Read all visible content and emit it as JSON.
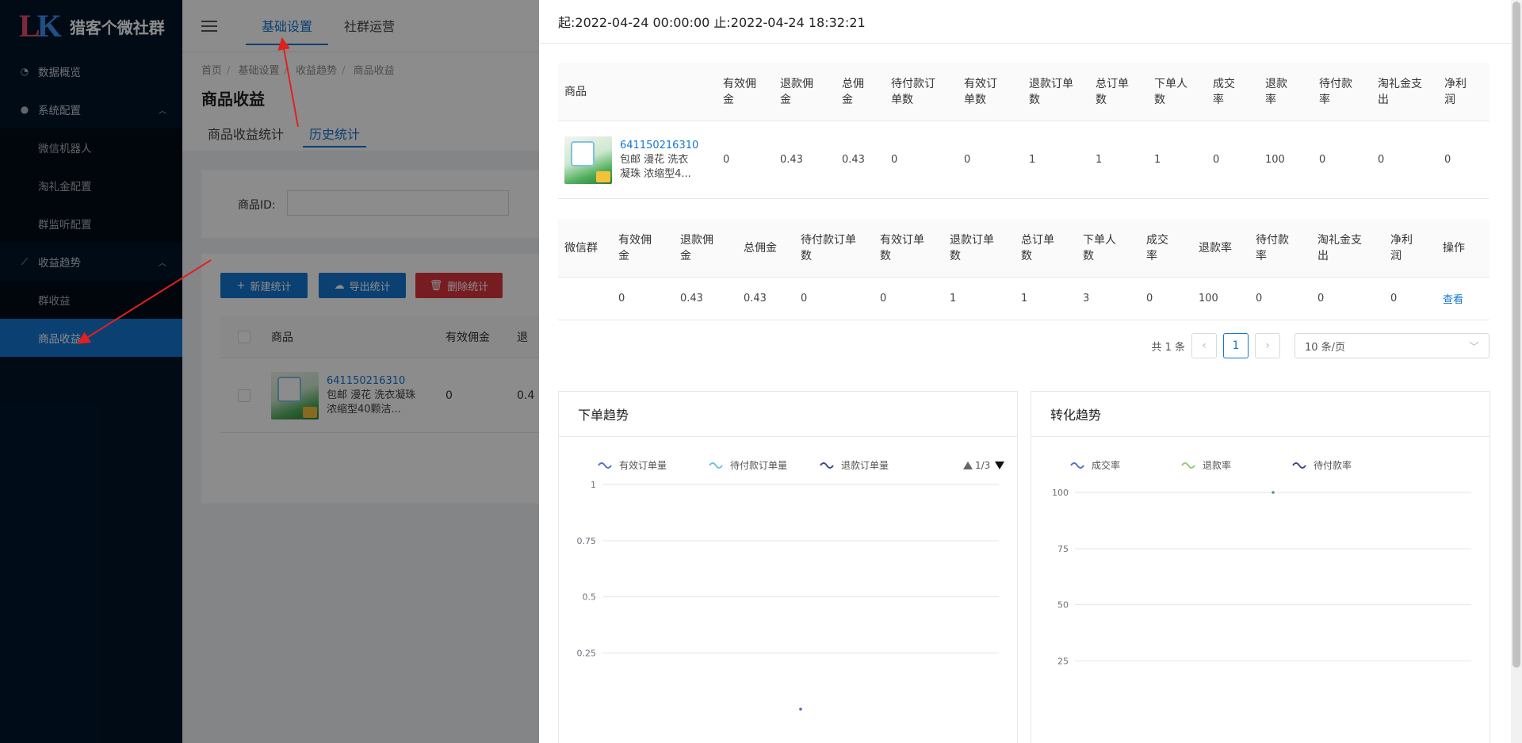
{
  "app": {
    "logo_mark_1": "L",
    "logo_mark_2": "K",
    "name": "猎客个微社群"
  },
  "sidebar": {
    "items": [
      {
        "label": "数据概览",
        "icon": "pie-chart-icon"
      },
      {
        "label": "系统配置",
        "icon": "wechat-icon"
      },
      {
        "label": "微信机器人"
      },
      {
        "label": "淘礼金配置"
      },
      {
        "label": "群监听配置"
      },
      {
        "label": "收益趋势",
        "icon": "line-chart-icon"
      },
      {
        "label": "群收益"
      },
      {
        "label": "商品收益"
      }
    ]
  },
  "topnav": {
    "tabs": [
      "基础设置",
      "社群运营"
    ]
  },
  "breadcrumb": [
    "首页",
    "基础设置",
    "收益趋势",
    "商品收益"
  ],
  "page": {
    "title": "商品收益",
    "sub_tabs": [
      "商品收益统计",
      "历史统计"
    ],
    "search_label": "商品ID:",
    "buttons": {
      "new": "新建统计",
      "export": "导出统计",
      "delete": "删除统计"
    },
    "list_headers": [
      "商品",
      "有效佣金",
      "退"
    ],
    "list_row": {
      "id": "641150216310",
      "desc": "包邮 漫花 洗衣凝珠 浓缩型40颗洁...",
      "effective": "0",
      "partial": "0.4"
    }
  },
  "drawer": {
    "range": "起:2022-04-24 00:00:00 止:2022-04-24 18:32:21",
    "table1": {
      "headers": [
        "商品",
        "有效佣金",
        "退款佣金",
        "总佣金",
        "待付款订单数",
        "有效订单数",
        "退款订单数",
        "总订单数",
        "下单人数",
        "成交率",
        "退款率",
        "待付款率",
        "淘礼金支出",
        "净利润"
      ],
      "row": {
        "id": "641150216310",
        "desc": "包邮 漫花 洗衣凝珠 浓缩型4...",
        "values": [
          "0",
          "0.43",
          "0.43",
          "0",
          "0",
          "1",
          "1",
          "1",
          "0",
          "100",
          "0",
          "0",
          "0"
        ]
      }
    },
    "table2": {
      "headers": [
        "微信群",
        "有效佣金",
        "退款佣金",
        "总佣金",
        "待付款订单数",
        "有效订单数",
        "退款订单数",
        "总订单数",
        "下单人数",
        "成交率",
        "退款率",
        "待付款率",
        "淘礼金支出",
        "净利润",
        "操作"
      ],
      "row": {
        "values": [
          "",
          "0",
          "0.43",
          "0.43",
          "0",
          "0",
          "1",
          "1",
          "3",
          "0",
          "100",
          "0",
          "0",
          "0"
        ],
        "action": "查看"
      }
    },
    "pager": {
      "total": "共 1 条",
      "current": "1",
      "size": "10 条/页"
    }
  },
  "chart_data": [
    {
      "type": "line",
      "title": "下单趋势",
      "legend_page": "1/3",
      "series": [
        {
          "name": "有效订单量",
          "color": "#5470c6",
          "values": [
            0
          ]
        },
        {
          "name": "待付款订单量",
          "color": "#73c0de",
          "values": [
            0
          ]
        },
        {
          "name": "退款订单量",
          "color": "#3c4a8a",
          "values": [
            0
          ]
        }
      ],
      "ylim": [
        0,
        1
      ],
      "yticks": [
        "1",
        "0.75",
        "0.5",
        "0.25"
      ],
      "point_color": "#5470c6"
    },
    {
      "type": "line",
      "title": "转化趋势",
      "series": [
        {
          "name": "成交率",
          "color": "#5470c6",
          "values": [
            100
          ]
        },
        {
          "name": "退款率",
          "color": "#91cc75",
          "values": [
            100
          ]
        },
        {
          "name": "待付款率",
          "color": "#3c4a8a",
          "values": [
            100
          ]
        }
      ],
      "ylim": [
        0,
        100
      ],
      "yticks": [
        "100",
        "75",
        "50",
        "25"
      ],
      "point_color": "#3ba272"
    }
  ]
}
